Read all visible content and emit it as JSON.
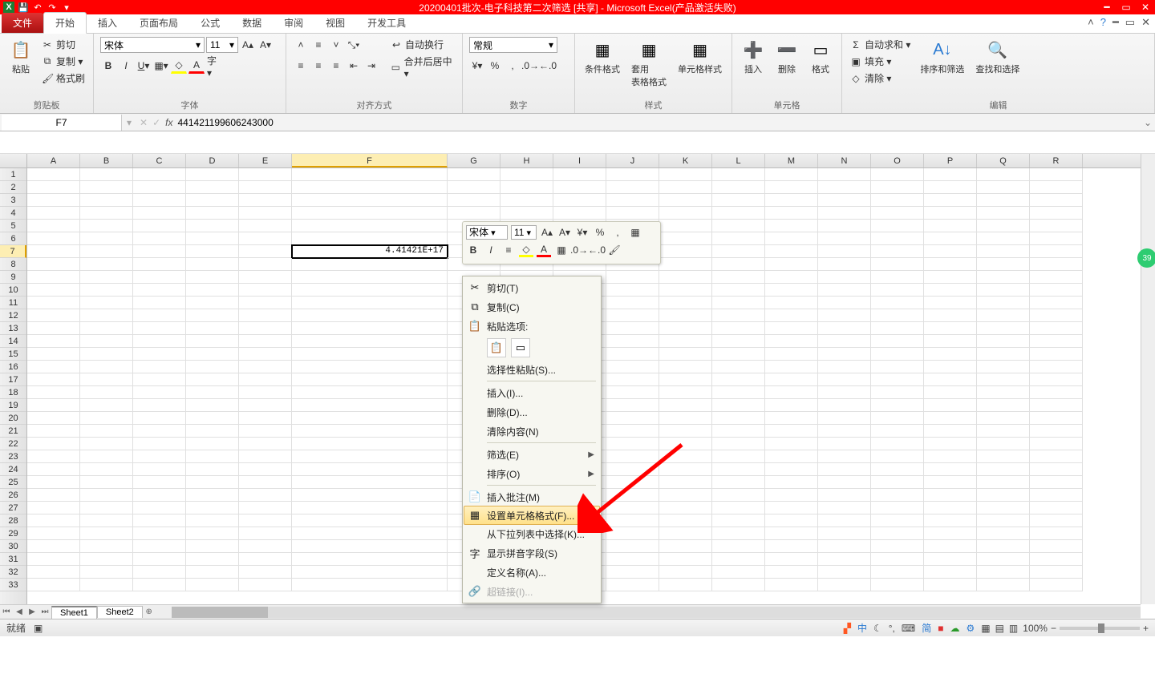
{
  "title": "20200401批次-电子科技第二次筛选  [共享]  -  Microsoft Excel(产品激活失败)",
  "tabs": {
    "file": "文件",
    "home": "开始",
    "insert": "插入",
    "layout": "页面布局",
    "formulas": "公式",
    "data": "数据",
    "review": "审阅",
    "view": "视图",
    "dev": "开发工具"
  },
  "ribbon": {
    "clipboard": {
      "label": "剪贴板",
      "paste": "粘贴",
      "cut": "剪切",
      "copy": "复制 ▾",
      "painter": "格式刷"
    },
    "font": {
      "label": "字体",
      "name": "宋体",
      "size": "11"
    },
    "align": {
      "label": "对齐方式",
      "wrap": "自动换行",
      "merge": "合并后居中 ▾"
    },
    "number": {
      "label": "数字",
      "format": "常规"
    },
    "styles": {
      "label": "样式",
      "cond": "条件格式",
      "tbl": "套用\n表格格式",
      "cell": "单元格样式"
    },
    "cells": {
      "label": "单元格",
      "ins": "插入",
      "del": "删除",
      "fmt": "格式"
    },
    "editing": {
      "label": "编辑",
      "sum": "自动求和 ▾",
      "fill": "填充 ▾",
      "clear": "清除 ▾",
      "sort": "排序和筛选",
      "find": "查找和选择"
    }
  },
  "namebox": "F7",
  "formula": "441421199606243000",
  "columns": [
    "A",
    "B",
    "C",
    "D",
    "E",
    "F",
    "G",
    "H",
    "I",
    "J",
    "K",
    "L",
    "M",
    "N",
    "O",
    "P",
    "Q",
    "R"
  ],
  "selectedCol": "F",
  "selectedRow": 7,
  "cellValue": "4.41421E+17",
  "sheets": {
    "s1": "Sheet1",
    "s2": "Sheet2"
  },
  "status": {
    "ready": "就绪",
    "zoom": "100%"
  },
  "ime": {
    "a": "中",
    "b": "简"
  },
  "minibar": {
    "font": "宋体",
    "size": "11"
  },
  "context": {
    "cut": "剪切(T)",
    "copy": "复制(C)",
    "pasteopts": "粘贴选项:",
    "pastespecial": "选择性粘贴(S)...",
    "insert": "插入(I)...",
    "delete": "删除(D)...",
    "clear": "清除内容(N)",
    "filter": "筛选(E)",
    "sort": "排序(O)",
    "comment": "插入批注(M)",
    "formatcells": "设置单元格格式(F)...",
    "dropdown": "从下拉列表中选择(K)...",
    "phonetic": "显示拼音字段(S)",
    "definename": "定义名称(A)...",
    "hyperlink": "超链接(I)..."
  },
  "badge": "39",
  "colwidths": {
    "A": 66,
    "B": 66,
    "C": 66,
    "D": 66,
    "E": 66,
    "F": 194,
    "G": 66,
    "H": 66,
    "I": 66,
    "J": 66,
    "K": 66,
    "L": 66,
    "M": 66,
    "N": 66,
    "O": 66,
    "P": 66,
    "Q": 66,
    "R": 66
  }
}
